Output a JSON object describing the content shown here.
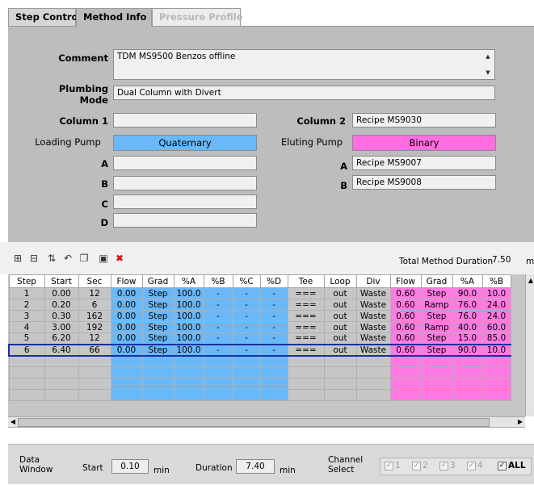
{
  "tabs": [
    "Step Control",
    "Method Info",
    "Pressure Profile"
  ],
  "method": {
    "comment_label": "Comment",
    "comment_value": "TDM MS9500 Benzos offline",
    "plumbing_label": "Plumbing Mode",
    "plumbing_value": "Dual Column with Divert",
    "column1_label": "Column 1",
    "column1_value": "",
    "column2_label": "Column 2",
    "column2_value": "Recipe MS9030",
    "loading_pump_label": "Loading Pump",
    "loading_pump_value": "Quaternary",
    "eluting_pump_label": "Eluting Pump",
    "eluting_pump_value": "Binary",
    "a_label": "A",
    "b_label": "B",
    "c_label": "C",
    "d_label": "D",
    "loading_a": "",
    "loading_b": "",
    "loading_c": "",
    "loading_d": "",
    "eluting_a": "Recipe MS9007",
    "eluting_b": "Recipe MS9008"
  },
  "toolbar": {
    "icons": [
      "insert-row-icon",
      "delete-row-icon",
      "sort-icon",
      "undo-icon",
      "copy-icon",
      "paste-icon",
      "clear-icon"
    ],
    "duration_label": "Total Method Duration",
    "duration_value": "7.50",
    "duration_unit": "mi"
  },
  "table": {
    "headers": [
      "Step",
      "Start",
      "Sec",
      "Flow",
      "Grad",
      "%A",
      "%B",
      "%C",
      "%D",
      "Tee",
      "Loop",
      "Div",
      "Flow",
      "Grad",
      "%A",
      "%B"
    ],
    "rows": [
      [
        "1",
        "0.00",
        "12",
        "0.00",
        "Step",
        "100.0",
        "-",
        "-",
        "-",
        "===",
        "out",
        "Waste",
        "0.60",
        "Step",
        "90.0",
        "10.0"
      ],
      [
        "2",
        "0.20",
        "6",
        "0.00",
        "Step",
        "100.0",
        "-",
        "-",
        "-",
        "===",
        "out",
        "Waste",
        "0.60",
        "Ramp",
        "76.0",
        "24.0"
      ],
      [
        "3",
        "0.30",
        "162",
        "0.00",
        "Step",
        "100.0",
        "-",
        "-",
        "-",
        "===",
        "out",
        "Waste",
        "0.60",
        "Step",
        "76.0",
        "24.0"
      ],
      [
        "4",
        "3.00",
        "192",
        "0.00",
        "Step",
        "100.0",
        "-",
        "-",
        "-",
        "===",
        "out",
        "Waste",
        "0.60",
        "Ramp",
        "40.0",
        "60.0"
      ],
      [
        "5",
        "6.20",
        "12",
        "0.00",
        "Step",
        "100.0",
        "-",
        "-",
        "-",
        "===",
        "out",
        "Waste",
        "0.60",
        "Step",
        "15.0",
        "85.0"
      ],
      [
        "6",
        "6.40",
        "66",
        "0.00",
        "Step",
        "100.0",
        "-",
        "-",
        "-",
        "===",
        "out",
        "Waste",
        "0.60",
        "Step",
        "90.0",
        "10.0"
      ]
    ],
    "selected_row": 6,
    "empty_rows": 4,
    "colors": {
      "quaternary": "#6ab8f8",
      "binary": "#ff7ae2",
      "selection": "#1830a0"
    }
  },
  "data_window": {
    "label": "Data Window",
    "start_label": "Start",
    "start_value": "0.10",
    "start_unit": "min",
    "duration_label": "Duration",
    "duration_value": "7.40",
    "duration_unit": "min"
  },
  "channel": {
    "label": "Channel Select",
    "items": [
      "1",
      "2",
      "3",
      "4"
    ],
    "all_label": "ALL",
    "all_checked": true
  }
}
